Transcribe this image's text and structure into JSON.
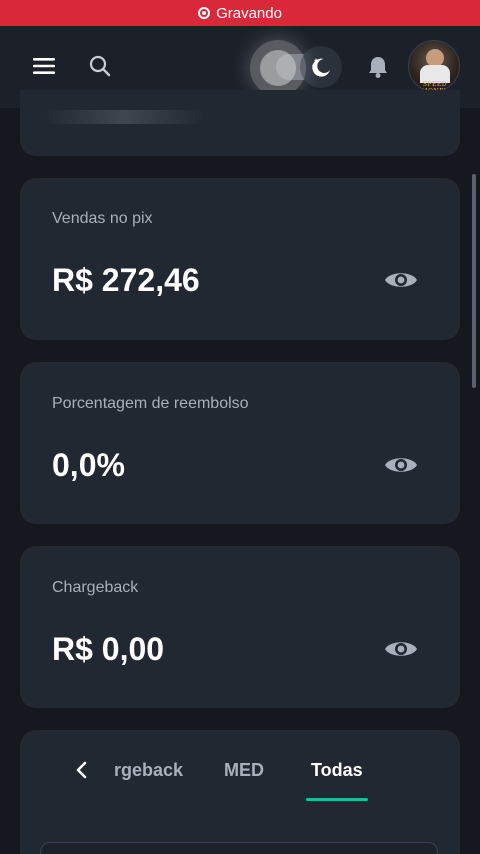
{
  "recording": {
    "label": "Gravando"
  },
  "header": {
    "menu_icon": "hamburger-menu-icon",
    "search_icon": "search-icon",
    "theme_icon": "moon-stars-icon",
    "bell_icon": "bell-icon",
    "avatar_text": "SPEED MONEY"
  },
  "cards": [
    {
      "label": "Vendas no pix",
      "value": "R$ 272,46"
    },
    {
      "label": "Porcentagem de reembolso",
      "value": "0,0%"
    },
    {
      "label": "Chargeback",
      "value": "R$ 0,00"
    }
  ],
  "tabs": {
    "items": [
      "rgeback",
      "MED",
      "Todas"
    ],
    "active": "Todas"
  },
  "colors": {
    "background": "#15191f",
    "card": "#222831",
    "recording_bar": "#d9283a",
    "accent": "#2bb59b",
    "muted_text": "#a9b0bb"
  }
}
